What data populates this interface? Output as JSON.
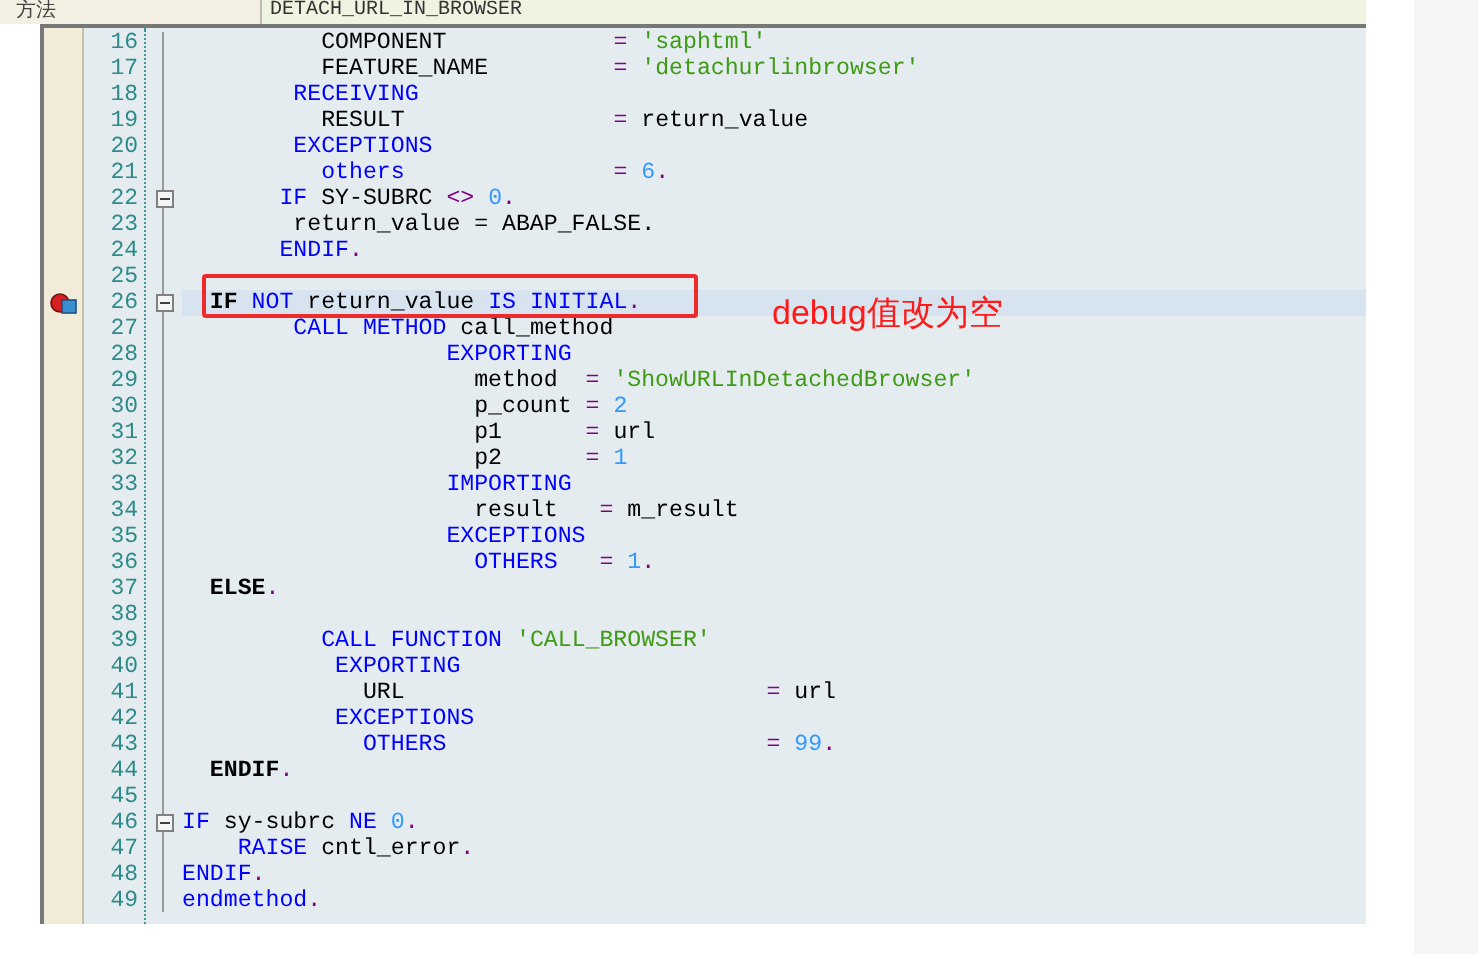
{
  "header": {
    "label": "方法",
    "value": "DETACH_URL_IN_BROWSER"
  },
  "annotation": {
    "text": "debug值改为空"
  },
  "lines": [
    {
      "number": "16",
      "fold": false,
      "selected": false,
      "breakpoint": false,
      "tokens": [
        {
          "text": "          COMPONENT            ",
          "kind": "plain"
        },
        {
          "text": "= ",
          "kind": "op"
        },
        {
          "text": "'saphtml'",
          "kind": "str"
        }
      ]
    },
    {
      "number": "17",
      "fold": false,
      "selected": false,
      "breakpoint": false,
      "tokens": [
        {
          "text": "          FEATURE_NAME         ",
          "kind": "plain"
        },
        {
          "text": "= ",
          "kind": "op"
        },
        {
          "text": "'detachurlinbrowser'",
          "kind": "str"
        }
      ]
    },
    {
      "number": "18",
      "fold": false,
      "selected": false,
      "breakpoint": false,
      "tokens": [
        {
          "text": "        RECEIVING",
          "kind": "kw"
        }
      ]
    },
    {
      "number": "19",
      "fold": false,
      "selected": false,
      "breakpoint": false,
      "tokens": [
        {
          "text": "          RESULT               ",
          "kind": "plain"
        },
        {
          "text": "=",
          "kind": "op"
        },
        {
          "text": " return_value",
          "kind": "plain"
        }
      ]
    },
    {
      "number": "20",
      "fold": false,
      "selected": false,
      "breakpoint": false,
      "tokens": [
        {
          "text": "        EXCEPTIONS",
          "kind": "kw"
        }
      ]
    },
    {
      "number": "21",
      "fold": false,
      "selected": false,
      "breakpoint": false,
      "tokens": [
        {
          "text": "          others               ",
          "kind": "kw"
        },
        {
          "text": "= ",
          "kind": "op"
        },
        {
          "text": "6",
          "kind": "num"
        },
        {
          "text": ".",
          "kind": "op"
        }
      ]
    },
    {
      "number": "22",
      "fold": true,
      "selected": false,
      "breakpoint": false,
      "tokens": [
        {
          "text": "       IF",
          "kind": "kw"
        },
        {
          "text": " SY-SUBRC ",
          "kind": "plain"
        },
        {
          "text": "<> ",
          "kind": "op"
        },
        {
          "text": "0",
          "kind": "num"
        },
        {
          "text": ".",
          "kind": "op"
        }
      ]
    },
    {
      "number": "23",
      "fold": false,
      "selected": false,
      "breakpoint": false,
      "tokens": [
        {
          "text": "        return_value = ABAP_FALSE.",
          "kind": "plain"
        }
      ]
    },
    {
      "number": "24",
      "fold": false,
      "selected": false,
      "breakpoint": false,
      "tokens": [
        {
          "text": "       ENDIF",
          "kind": "kw"
        },
        {
          "text": ".",
          "kind": "op"
        }
      ]
    },
    {
      "number": "25",
      "fold": false,
      "selected": false,
      "breakpoint": false
    },
    {
      "number": "26",
      "fold": true,
      "selected": true,
      "breakpoint": true,
      "tokens": [
        {
          "text": "  IF ",
          "kind": "bold"
        },
        {
          "text": "NOT",
          "kind": "kw"
        },
        {
          "text": " return_value ",
          "kind": "plain"
        },
        {
          "text": "IS INITIAL",
          "kind": "kw"
        },
        {
          "text": ".",
          "kind": "op"
        }
      ]
    },
    {
      "number": "27",
      "fold": false,
      "selected": false,
      "breakpoint": false,
      "tokens": [
        {
          "text": "        CALL METHOD",
          "kind": "kw"
        },
        {
          "text": " call_method",
          "kind": "plain"
        }
      ]
    },
    {
      "number": "28",
      "fold": false,
      "selected": false,
      "breakpoint": false,
      "tokens": [
        {
          "text": "                   EXPORTING",
          "kind": "kw"
        }
      ]
    },
    {
      "number": "29",
      "fold": false,
      "selected": false,
      "breakpoint": false,
      "tokens": [
        {
          "text": "                     method  ",
          "kind": "plain"
        },
        {
          "text": "= ",
          "kind": "op"
        },
        {
          "text": "'ShowURLInDetachedBrowser'",
          "kind": "str"
        }
      ]
    },
    {
      "number": "30",
      "fold": false,
      "selected": false,
      "breakpoint": false,
      "tokens": [
        {
          "text": "                     p_count ",
          "kind": "plain"
        },
        {
          "text": "= ",
          "kind": "op"
        },
        {
          "text": "2",
          "kind": "num"
        }
      ]
    },
    {
      "number": "31",
      "fold": false,
      "selected": false,
      "breakpoint": false,
      "tokens": [
        {
          "text": "                     p1      ",
          "kind": "plain"
        },
        {
          "text": "=",
          "kind": "op"
        },
        {
          "text": " url",
          "kind": "plain"
        }
      ]
    },
    {
      "number": "32",
      "fold": false,
      "selected": false,
      "breakpoint": false,
      "tokens": [
        {
          "text": "                     p2      ",
          "kind": "plain"
        },
        {
          "text": "= ",
          "kind": "op"
        },
        {
          "text": "1",
          "kind": "num"
        }
      ]
    },
    {
      "number": "33",
      "fold": false,
      "selected": false,
      "breakpoint": false,
      "tokens": [
        {
          "text": "                   IMPORTING",
          "kind": "kw"
        }
      ]
    },
    {
      "number": "34",
      "fold": false,
      "selected": false,
      "breakpoint": false,
      "tokens": [
        {
          "text": "                     result   ",
          "kind": "plain"
        },
        {
          "text": "=",
          "kind": "op"
        },
        {
          "text": " m_result",
          "kind": "plain"
        }
      ]
    },
    {
      "number": "35",
      "fold": false,
      "selected": false,
      "breakpoint": false,
      "tokens": [
        {
          "text": "                   EXCEPTIONS",
          "kind": "kw"
        }
      ]
    },
    {
      "number": "36",
      "fold": false,
      "selected": false,
      "breakpoint": false,
      "tokens": [
        {
          "text": "                     OTHERS   ",
          "kind": "kw"
        },
        {
          "text": "= ",
          "kind": "op"
        },
        {
          "text": "1",
          "kind": "num"
        },
        {
          "text": ".",
          "kind": "op"
        }
      ]
    },
    {
      "number": "37",
      "fold": false,
      "selected": false,
      "breakpoint": false,
      "tokens": [
        {
          "text": "  ELSE",
          "kind": "bold"
        },
        {
          "text": ".",
          "kind": "op"
        }
      ]
    },
    {
      "number": "38",
      "fold": false,
      "selected": false,
      "breakpoint": false
    },
    {
      "number": "39",
      "fold": false,
      "selected": false,
      "breakpoint": false,
      "tokens": [
        {
          "text": "          CALL FUNCTION ",
          "kind": "kw"
        },
        {
          "text": "'CALL_BROWSER'",
          "kind": "str"
        }
      ]
    },
    {
      "number": "40",
      "fold": false,
      "selected": false,
      "breakpoint": false,
      "tokens": [
        {
          "text": "           EXPORTING",
          "kind": "kw"
        }
      ]
    },
    {
      "number": "41",
      "fold": false,
      "selected": false,
      "breakpoint": false,
      "tokens": [
        {
          "text": "             URL                          ",
          "kind": "plain"
        },
        {
          "text": "=",
          "kind": "op"
        },
        {
          "text": " url",
          "kind": "plain"
        }
      ]
    },
    {
      "number": "42",
      "fold": false,
      "selected": false,
      "breakpoint": false,
      "tokens": [
        {
          "text": "           EXCEPTIONS",
          "kind": "kw"
        }
      ]
    },
    {
      "number": "43",
      "fold": false,
      "selected": false,
      "breakpoint": false,
      "tokens": [
        {
          "text": "             OTHERS                       ",
          "kind": "kw"
        },
        {
          "text": "= ",
          "kind": "op"
        },
        {
          "text": "99",
          "kind": "num"
        },
        {
          "text": ".",
          "kind": "op"
        }
      ]
    },
    {
      "number": "44",
      "fold": false,
      "selected": false,
      "breakpoint": false,
      "tokens": [
        {
          "text": "  ENDIF",
          "kind": "bold"
        },
        {
          "text": ".",
          "kind": "op"
        }
      ]
    },
    {
      "number": "45",
      "fold": false,
      "selected": false,
      "breakpoint": false
    },
    {
      "number": "46",
      "fold": true,
      "selected": false,
      "breakpoint": false,
      "tokens": [
        {
          "text": "IF",
          "kind": "kw"
        },
        {
          "text": " sy-subrc ",
          "kind": "plain"
        },
        {
          "text": "NE ",
          "kind": "kw"
        },
        {
          "text": "0",
          "kind": "num"
        },
        {
          "text": ".",
          "kind": "op"
        }
      ]
    },
    {
      "number": "47",
      "fold": false,
      "selected": false,
      "breakpoint": false,
      "tokens": [
        {
          "text": "    RAISE",
          "kind": "kw"
        },
        {
          "text": " cntl_error",
          "kind": "plain"
        },
        {
          "text": ".",
          "kind": "op"
        }
      ]
    },
    {
      "number": "48",
      "fold": false,
      "selected": false,
      "breakpoint": false,
      "tokens": [
        {
          "text": "ENDIF",
          "kind": "kw"
        },
        {
          "text": ".",
          "kind": "op"
        }
      ]
    },
    {
      "number": "49",
      "fold": false,
      "selected": false,
      "breakpoint": false,
      "tokens": [
        {
          "text": "endmethod",
          "kind": "kw"
        },
        {
          "text": ".",
          "kind": "op"
        }
      ]
    }
  ]
}
